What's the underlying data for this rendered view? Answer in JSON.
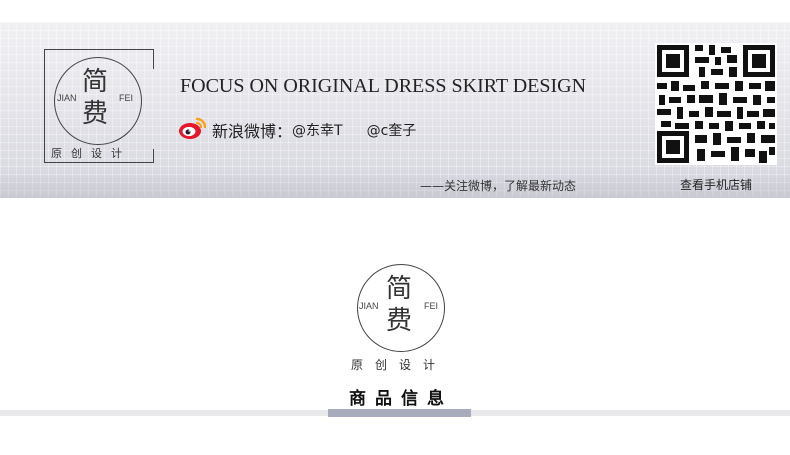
{
  "brand": {
    "logo_char_top": "简",
    "logo_char_bottom": "费",
    "logo_left": "JIAN",
    "logo_right": "FEI",
    "logo_subtitle": "原创设计"
  },
  "header": {
    "tagline": "FOCUS ON ORIGINAL DRESS SKIRT DESIGN",
    "weibo_label": "新浪微博：",
    "weibo_handle_1": "@东幸T",
    "weibo_handle_2": "@c奎子",
    "follow_note": "——关注微博，了解最新动态",
    "qr_caption": "查看手机店铺"
  },
  "section": {
    "title": "商品信息"
  },
  "colors": {
    "banner_bg": "#e7e7ec",
    "accent_bar": "#a7abbb",
    "weibo_red": "#e6162d",
    "weibo_orange": "#f7a21b"
  },
  "icons": [
    "weibo-icon",
    "qr-code-icon"
  ]
}
